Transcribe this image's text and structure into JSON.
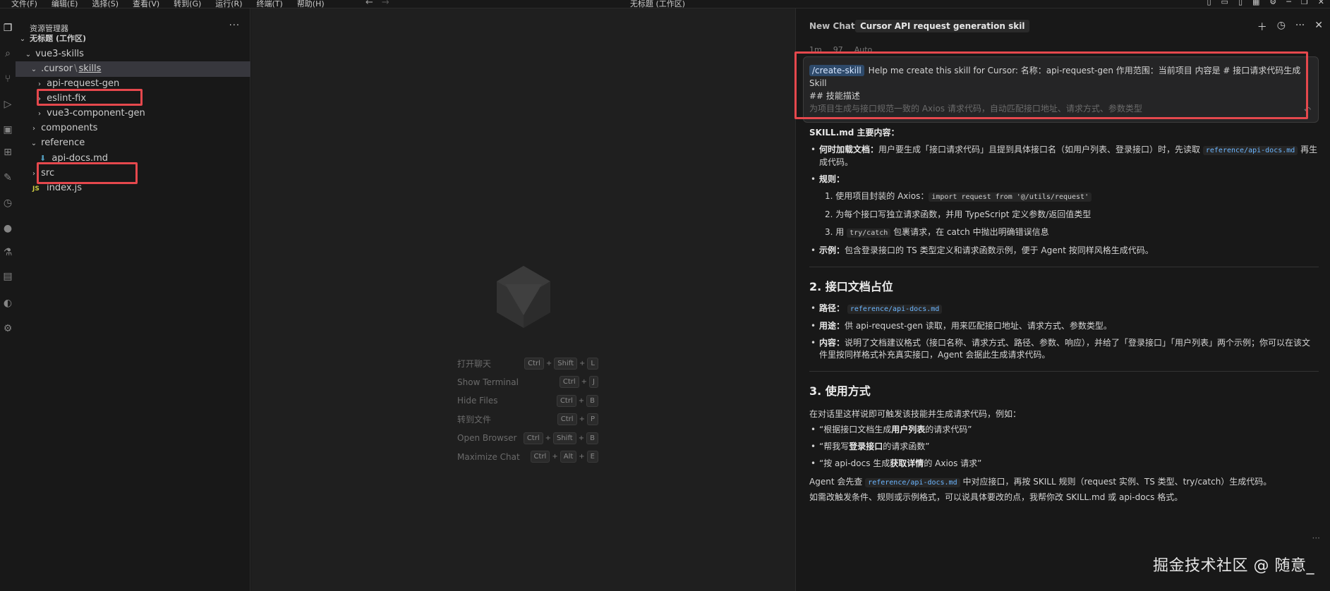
{
  "menu": [
    "文件(F)",
    "编辑(E)",
    "选择(S)",
    "查看(V)",
    "转到(G)",
    "运行(R)",
    "终端(T)",
    "帮助(H)"
  ],
  "window_title": "无标题 (工作区)",
  "explorer": {
    "header": "资源管理器",
    "more": "···",
    "workspace": "无标题 (工作区)",
    "rows": {
      "vue3": "vue3-skills",
      "cursor": ".cursor",
      "skills": "skills",
      "api_request_gen": "api-request-gen",
      "eslint_fix": "eslint-fix",
      "vue3_component_gen": "vue3-component-gen",
      "components": "components",
      "reference": "reference",
      "api_docs": "api-docs.md",
      "src": "src",
      "index_js": "index.js",
      "js_badge": "JS"
    }
  },
  "shortcuts": [
    {
      "label": "打开聊天",
      "keys": [
        "Ctrl",
        "Shift",
        "L"
      ]
    },
    {
      "label": "Show Terminal",
      "keys": [
        "Ctrl",
        "J"
      ]
    },
    {
      "label": "Hide Files",
      "keys": [
        "Ctrl",
        "B"
      ]
    },
    {
      "label": "转到文件",
      "keys": [
        "Ctrl",
        "P"
      ]
    },
    {
      "label": "Open Browser",
      "keys": [
        "Ctrl",
        "Shift",
        "B"
      ]
    },
    {
      "label": "Maximize Chat",
      "keys": [
        "Ctrl",
        "Alt",
        "E"
      ]
    }
  ],
  "chat": {
    "tab_new": "New Chat",
    "tab_active": "Cursor API request generation skil",
    "meta": [
      "1m",
      "97",
      "Auto"
    ],
    "prompt": {
      "chip": "/create-skill",
      "line1": "Help me create this skill for Cursor: 名称：api-request-gen  作用范围：当前项目  内容是 # 接口请求代码生成 Skill",
      "line2": "## 技能描述",
      "line3": "为项目生成与接口规范一致的 Axios 请求代码，自动匹配接口地址、请求方式、参数类型"
    },
    "content": {
      "skill_title": "SKILL.md 主要内容：",
      "when_label": "何时加载文档：",
      "when_text": "用户要生成「接口请求代码」且提到具体接口名（如用户列表、登录接口）时，先读取",
      "when_code": "reference/api-docs.md",
      "when_after": "再生成代码。",
      "rules_label": "规则：",
      "rule1_pre": "1. 使用项目封装的 Axios：",
      "rule1_code": "import request from '@/utils/request'",
      "rule2": "2. 为每个接口写独立请求函数，并用 TypeScript 定义参数/返回值类型",
      "rule3_pre": "3. 用",
      "rule3_code": "try/catch",
      "rule3_post": "包裹请求，在 catch 中抛出明确错误信息",
      "example_label": "示例：",
      "example_text": "包含登录接口的 TS 类型定义和请求函数示例，便于 Agent 按同样风格生成代码。",
      "h2_2": "2. 接口文档占位",
      "path_label": "路径：",
      "path_code": "reference/api-docs.md",
      "use_label": "用途：",
      "use_text": "供 api-request-gen 读取，用来匹配接口地址、请求方式、参数类型。",
      "content_label": "内容：",
      "content_text": "说明了文档建议格式（接口名称、请求方式、路径、参数、响应），并给了「登录接口」「用户列表」两个示例；你可以在该文件里按同样格式补充真实接口，Agent 会据此生成请求代码。",
      "h2_3": "3. 使用方式",
      "usage_intro": "在对话里这样说即可触发该技能并生成请求代码，例如：",
      "q1_pre": "“根据接口文档生成",
      "q1_bold": "用户列表",
      "q1_post": "的请求代码”",
      "q2_pre": "“帮我写",
      "q2_bold": "登录接口",
      "q2_post": "的请求函数”",
      "q3_pre": "“按 api-docs 生成",
      "q3_bold": "获取详情",
      "q3_post": "的 Axios 请求”",
      "agent_pre": "Agent 会先查",
      "agent_code": "reference/api-docs.md",
      "agent_post": "中对应接口，再按 SKILL 规则（request 实例、TS 类型、try/catch）生成代码。",
      "closing": "如需改触发条件、规则或示例格式，可以说具体要改的点，我帮你改 SKILL.md 或 api-docs 格式。"
    },
    "more": "···"
  },
  "watermark": "掘金技术社区 @ 随意_",
  "colors": {
    "accent_red": "#e5484d",
    "chip_bg": "#2e4a6b",
    "link": "#6cb6ff"
  }
}
